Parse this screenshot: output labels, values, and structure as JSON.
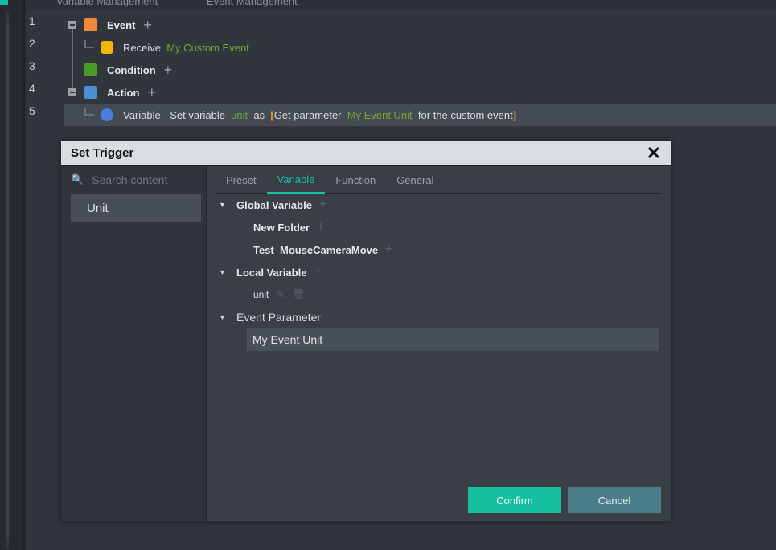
{
  "top_tabs": [
    "Variable Management",
    "Event Management"
  ],
  "lines": [
    "1",
    "2",
    "3",
    "4",
    "5"
  ],
  "tree": {
    "event": "Event",
    "receive": "Receive",
    "custom_event": "My Custom Event",
    "condition": "Condition",
    "action": "Action",
    "action_row": {
      "prefix": "Variable - Set variable",
      "var": "unit",
      "as": "as",
      "open": "[",
      "get": "Get parameter",
      "param": "My Event Unit",
      "suffix": "for the custom event",
      "close": "]"
    }
  },
  "dialog": {
    "title": "Set Trigger",
    "close": "✕",
    "search_placeholder": "Search content",
    "categories": [
      "Unit"
    ],
    "tabs": [
      "Preset",
      "Variable",
      "Function",
      "General"
    ],
    "active_tab": "Variable",
    "global": "Global Variable",
    "folder1": "New Folder",
    "folder2": "Test_MouseCameraMove",
    "local": "Local Variable",
    "local_var": "unit",
    "event_param": "Event Parameter",
    "event_param_item": "My Event Unit",
    "confirm": "Confirm",
    "cancel": "Cancel"
  },
  "colors": {
    "accent": "#14bfa0",
    "green_text": "#6fa83a"
  }
}
